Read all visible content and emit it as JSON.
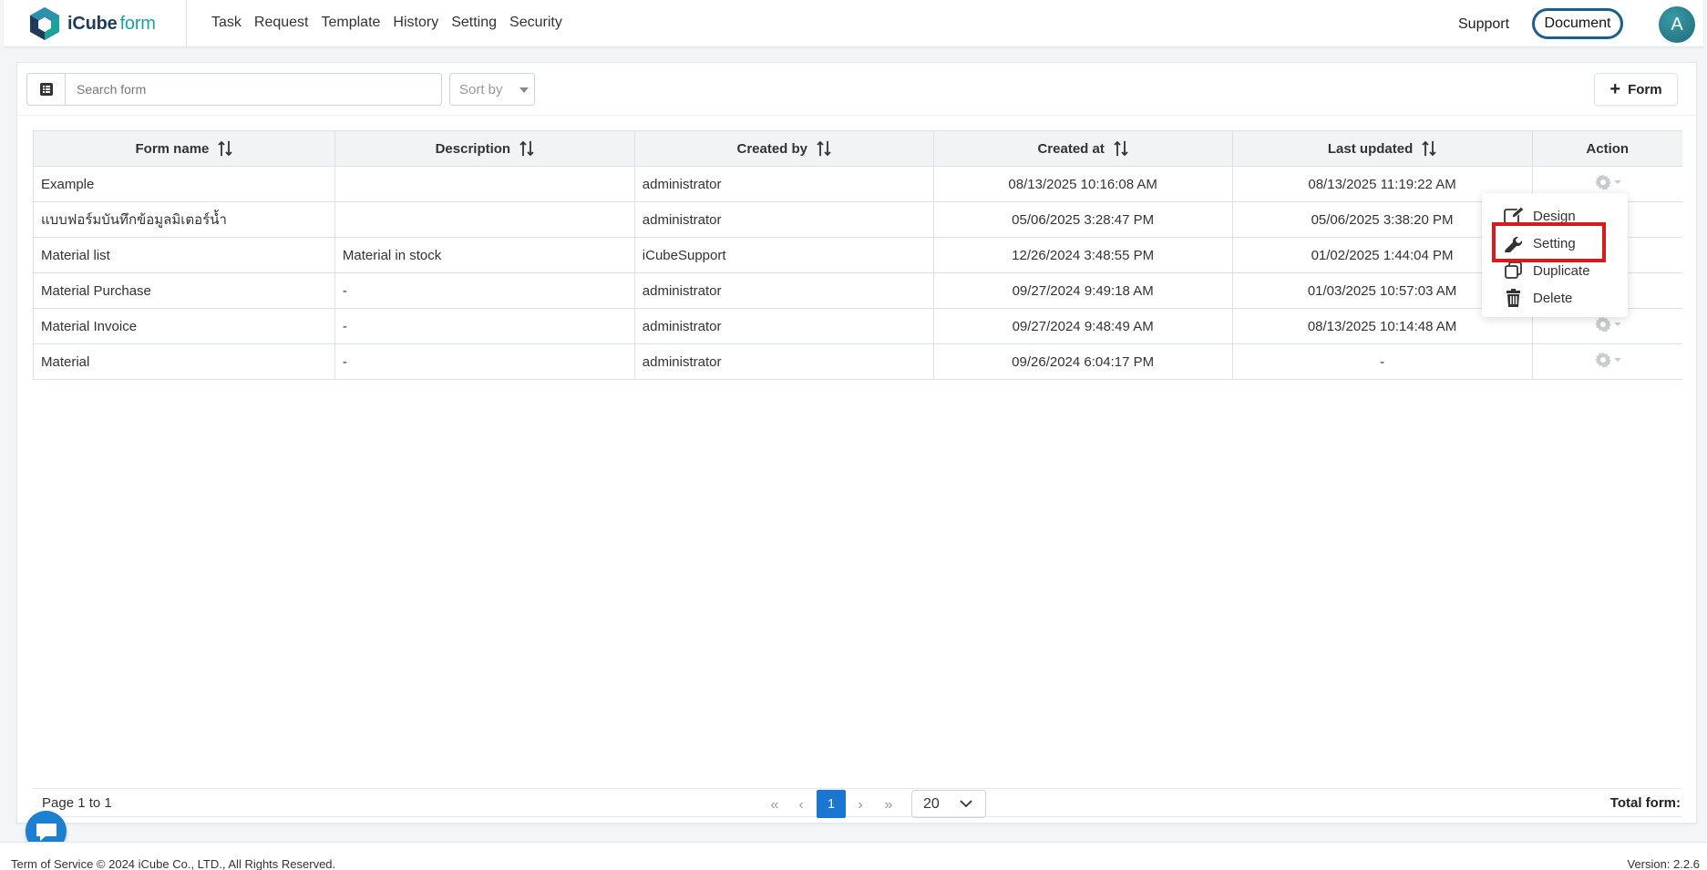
{
  "brand": {
    "name": "iCube",
    "suffix": "form"
  },
  "nav": {
    "items": [
      "Task",
      "Request",
      "Template",
      "History",
      "Setting",
      "Security"
    ]
  },
  "header": {
    "support_label": "Support",
    "document_label": "Document",
    "avatar_initial": "A"
  },
  "toolbar": {
    "search_placeholder": "Search form",
    "sort_label": "Sort by",
    "add_form_label": "Form"
  },
  "table": {
    "columns": [
      "Form name",
      "Description",
      "Created by",
      "Created at",
      "Last updated",
      "Action"
    ],
    "rows": [
      {
        "name": "Example",
        "description": "",
        "created_by": "administrator",
        "created_at": "08/13/2025 10:16:08 AM",
        "last_updated": "08/13/2025 11:19:22 AM"
      },
      {
        "name": "แบบฟอร์มบันทึกข้อมูลมิเตอร์น้ำ",
        "description": "",
        "created_by": "administrator",
        "created_at": "05/06/2025 3:28:47 PM",
        "last_updated": "05/06/2025 3:38:20 PM"
      },
      {
        "name": "Material list",
        "description": "Material in stock",
        "created_by": "iCubeSupport",
        "created_at": "12/26/2024 3:48:55 PM",
        "last_updated": "01/02/2025 1:44:04 PM"
      },
      {
        "name": "Material Purchase",
        "description": "-",
        "created_by": "administrator",
        "created_at": "09/27/2024 9:49:18 AM",
        "last_updated": "01/03/2025 10:57:03 AM"
      },
      {
        "name": "Material Invoice",
        "description": "-",
        "created_by": "administrator",
        "created_at": "09/27/2024 9:48:49 AM",
        "last_updated": "08/13/2025 10:14:48 AM"
      },
      {
        "name": "Material",
        "description": "-",
        "created_by": "administrator",
        "created_at": "09/26/2024 6:04:17 PM",
        "last_updated": "-"
      }
    ]
  },
  "action_menu": {
    "items": [
      "Design",
      "Setting",
      "Duplicate",
      "Delete"
    ]
  },
  "pagination": {
    "page_info": "Page 1 to 1",
    "current_page": "1",
    "page_size": "20",
    "total_label": "Total form:"
  },
  "footer": {
    "copyright": "Term of Service © 2024 iCube Co., LTD., All Rights Reserved.",
    "version": "Version: 2.2.6"
  },
  "colors": {
    "accent": "#1976d2",
    "brand_dark": "#1f3b5a",
    "brand_teal": "#1aa39a",
    "highlight": "#d9191c"
  }
}
